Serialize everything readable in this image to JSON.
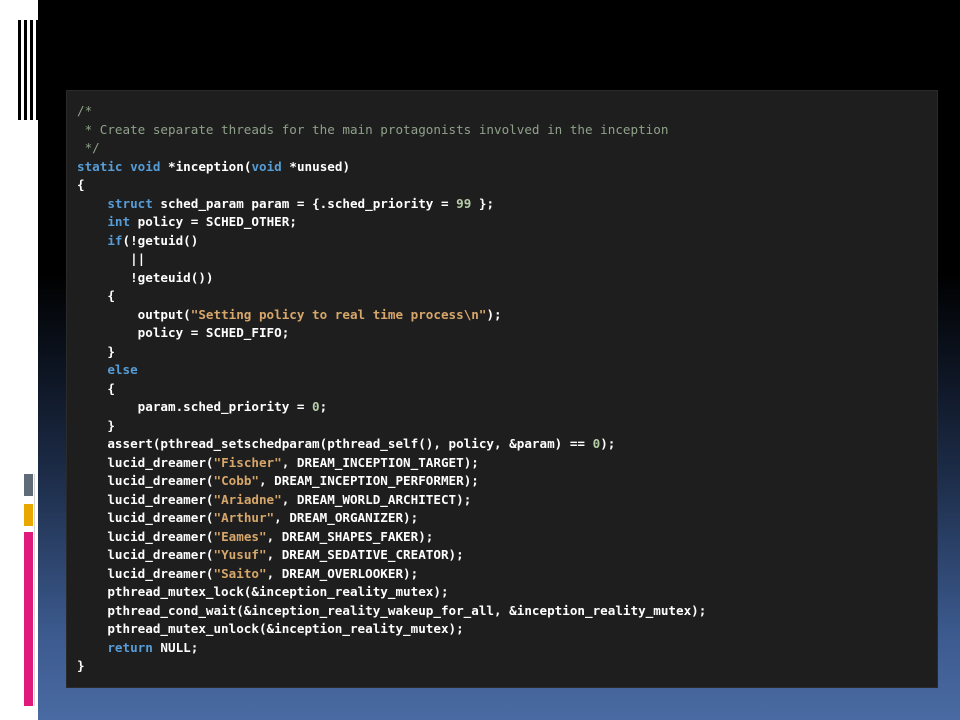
{
  "colors": {
    "slide_background_top": "#000000",
    "slide_background_bottom": "#4a6aa3",
    "editor_background": "#1e1e1e",
    "keyword": "#569cd6",
    "string": "#d6a66a",
    "number": "#b5cea8",
    "comment": "#8fa18a",
    "accent_gray": "#5f6b78",
    "accent_yellow": "#e8a800",
    "accent_pink": "#e0197d"
  },
  "code": {
    "language": "c",
    "lines": [
      [
        {
          "t": "/*",
          "c": "cm"
        }
      ],
      [
        {
          "t": " * Create separate threads for the main protagonists involved in the inception",
          "c": "cm"
        }
      ],
      [
        {
          "t": " */",
          "c": "cm"
        }
      ],
      [
        {
          "t": "static",
          "c": "kw"
        },
        {
          "t": " "
        },
        {
          "t": "void",
          "c": "kw"
        },
        {
          "t": " *inception("
        },
        {
          "t": "void",
          "c": "kw"
        },
        {
          "t": " *unused)"
        }
      ],
      [
        {
          "t": "{"
        }
      ],
      [
        {
          "t": "    "
        },
        {
          "t": "struct",
          "c": "kw"
        },
        {
          "t": " sched_param param = {.sched_priority = "
        },
        {
          "t": "99",
          "c": "num"
        },
        {
          "t": " };"
        }
      ],
      [
        {
          "t": "    "
        },
        {
          "t": "int",
          "c": "kw"
        },
        {
          "t": " policy = SCHED_OTHER;"
        }
      ],
      [
        {
          "t": "    "
        },
        {
          "t": "if",
          "c": "kw"
        },
        {
          "t": "(!getuid()"
        }
      ],
      [
        {
          "t": "       ||"
        }
      ],
      [
        {
          "t": "       !geteuid())"
        }
      ],
      [
        {
          "t": "    {"
        }
      ],
      [
        {
          "t": "        output("
        },
        {
          "t": "\"Setting policy to real time process\\n\"",
          "c": "str"
        },
        {
          "t": ");"
        }
      ],
      [
        {
          "t": "        policy = SCHED_FIFO;"
        }
      ],
      [
        {
          "t": "    }"
        }
      ],
      [
        {
          "t": "    "
        },
        {
          "t": "else",
          "c": "kw"
        }
      ],
      [
        {
          "t": "    {"
        }
      ],
      [
        {
          "t": "        param.sched_priority = "
        },
        {
          "t": "0",
          "c": "num"
        },
        {
          "t": ";"
        }
      ],
      [
        {
          "t": "    }"
        }
      ],
      [
        {
          "t": "    assert(pthread_setschedparam(pthread_self(), policy, &param) == "
        },
        {
          "t": "0",
          "c": "num"
        },
        {
          "t": ");"
        }
      ],
      [
        {
          "t": "    lucid_dreamer("
        },
        {
          "t": "\"Fischer\"",
          "c": "str"
        },
        {
          "t": ", DREAM_INCEPTION_TARGET);"
        }
      ],
      [
        {
          "t": "    lucid_dreamer("
        },
        {
          "t": "\"Cobb\"",
          "c": "str"
        },
        {
          "t": ", DREAM_INCEPTION_PERFORMER);"
        }
      ],
      [
        {
          "t": "    lucid_dreamer("
        },
        {
          "t": "\"Ariadne\"",
          "c": "str"
        },
        {
          "t": ", DREAM_WORLD_ARCHITECT);"
        }
      ],
      [
        {
          "t": "    lucid_dreamer("
        },
        {
          "t": "\"Arthur\"",
          "c": "str"
        },
        {
          "t": ", DREAM_ORGANIZER);"
        }
      ],
      [
        {
          "t": "    lucid_dreamer("
        },
        {
          "t": "\"Eames\"",
          "c": "str"
        },
        {
          "t": ", DREAM_SHAPES_FAKER);"
        }
      ],
      [
        {
          "t": "    lucid_dreamer("
        },
        {
          "t": "\"Yusuf\"",
          "c": "str"
        },
        {
          "t": ", DREAM_SEDATIVE_CREATOR);"
        }
      ],
      [
        {
          "t": "    lucid_dreamer("
        },
        {
          "t": "\"Saito\"",
          "c": "str"
        },
        {
          "t": ", DREAM_OVERLOOKER);"
        }
      ],
      [
        {
          "t": "    pthread_mutex_lock(&inception_reality_mutex);"
        }
      ],
      [
        {
          "t": "    pthread_cond_wait(&inception_reality_wakeup_for_all, &inception_reality_mutex);"
        }
      ],
      [
        {
          "t": "    pthread_mutex_unlock(&inception_reality_mutex);"
        }
      ],
      [
        {
          "t": "    "
        },
        {
          "t": "return",
          "c": "kw"
        },
        {
          "t": " NULL;"
        }
      ],
      [
        {
          "t": "}"
        }
      ]
    ]
  }
}
